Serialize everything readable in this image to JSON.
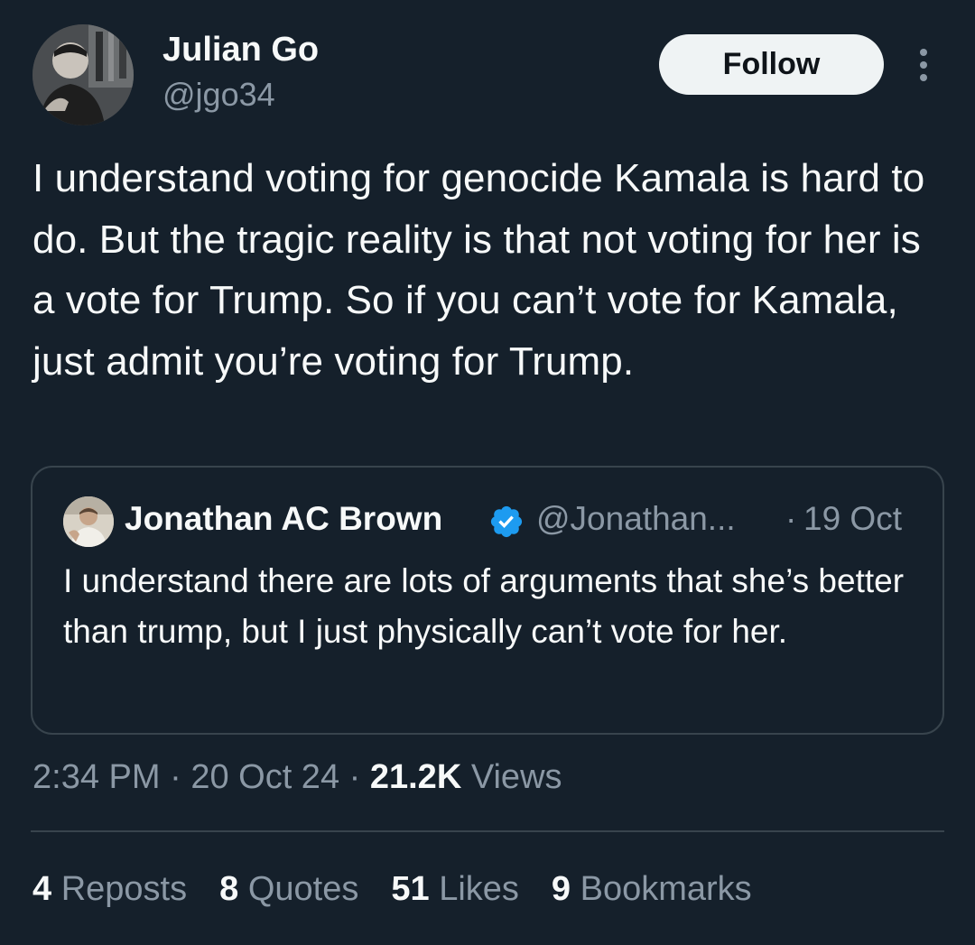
{
  "author": {
    "name": "Julian Go",
    "handle": "@jgo34",
    "follow_label": "Follow"
  },
  "icons": {
    "more": "more-vertical-icon",
    "verified": "verified-badge-icon"
  },
  "colors": {
    "background": "#15202b",
    "verified_blue": "#1d9bf0",
    "muted_text": "#8b98a5",
    "border": "#38444d"
  },
  "tweet": {
    "text": "I understand voting for genocide Kamala is hard to do. But the tragic reality is that not voting for her is a vote for Trump. So if you can’t vote for Kamala, just admit you’re voting for Trump."
  },
  "quote": {
    "name": "Jonathan AC Brown",
    "handle": "@Jonathan...",
    "separator": "·",
    "date": "19 Oct",
    "text": "I understand there are lots of arguments that she’s better than trump, but I just physically can’t vote for her."
  },
  "meta": {
    "time": "2:34 PM",
    "date": "20 Oct 24",
    "views_count": "21.2K",
    "views_label": "Views"
  },
  "stats": {
    "reposts_count": "4",
    "reposts_label": "Reposts",
    "quotes_count": "8",
    "quotes_label": "Quotes",
    "likes_count": "51",
    "likes_label": "Likes",
    "bookmarks_count": "9",
    "bookmarks_label": "Bookmarks"
  }
}
